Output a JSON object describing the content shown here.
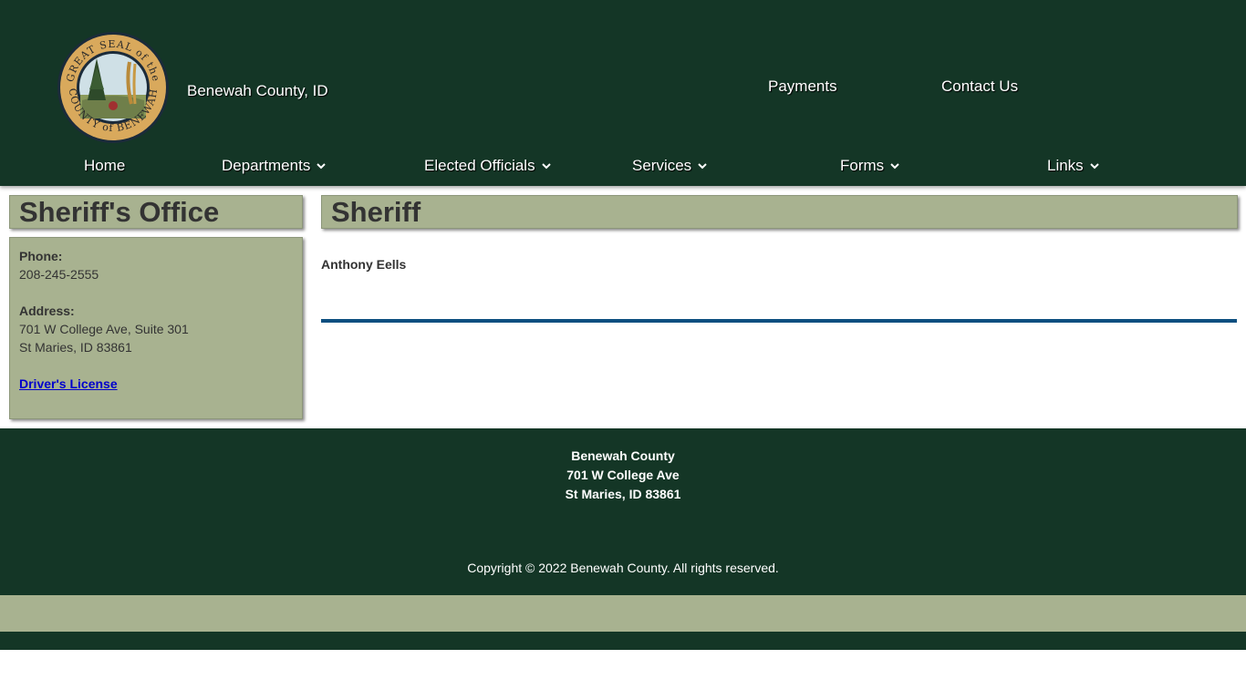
{
  "header": {
    "site_name": "Benewah County, ID",
    "seal_text_top": "GREAT SEAL of the",
    "seal_text_bottom": "COUNTY of BENEWAH",
    "top_links": [
      "Payments",
      "Contact Us"
    ]
  },
  "nav": {
    "items": [
      {
        "label": "Home",
        "dropdown": false
      },
      {
        "label": "Departments",
        "dropdown": true
      },
      {
        "label": "Elected Officials",
        "dropdown": true
      },
      {
        "label": "Services",
        "dropdown": true
      },
      {
        "label": "Forms",
        "dropdown": true
      },
      {
        "label": "Links",
        "dropdown": true
      }
    ]
  },
  "sidebar": {
    "title": "Sheriff's Office",
    "phone_label": "Phone:",
    "phone": "208-245-2555",
    "address_label": "Address:",
    "address_line1": "701 W College Ave, Suite 301",
    "address_line2": "St Maries, ID 83861",
    "link": "Driver's License"
  },
  "main": {
    "title": "Sheriff",
    "officer": "Anthony Eells"
  },
  "footer": {
    "name": "Benewah County",
    "address_line1": "701 W College Ave",
    "address_line2": "St Maries, ID 83861",
    "copyright": "Copyright © 2022 Benewah County. All rights reserved."
  },
  "colors": {
    "header_bg": "#143626",
    "sage": "#a8b290",
    "divider": "#0d4f80",
    "link": "#0000cc"
  }
}
